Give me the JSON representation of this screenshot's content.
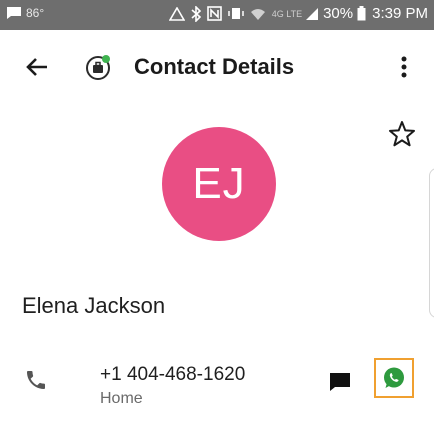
{
  "status_bar": {
    "temperature": "86°",
    "battery": "30%",
    "time": "3:39 PM",
    "network": "4G LTE",
    "icons": [
      "message-icon",
      "weather-icon",
      "bluetooth-icon",
      "nfc-icon",
      "vibrate-icon",
      "wifi-icon",
      "signal-icon",
      "battery-icon"
    ]
  },
  "app_bar": {
    "title": "Contact Details"
  },
  "contact": {
    "initials": "EJ",
    "name": "Elena Jackson",
    "avatar_color": "#e94e84",
    "phone": {
      "number": "+1 404-468-1620",
      "type": "Home"
    }
  },
  "colors": {
    "status_bar": "#6e6e6e",
    "highlight_border": "#f0a030",
    "whatsapp_green": "#2e9a3e"
  }
}
